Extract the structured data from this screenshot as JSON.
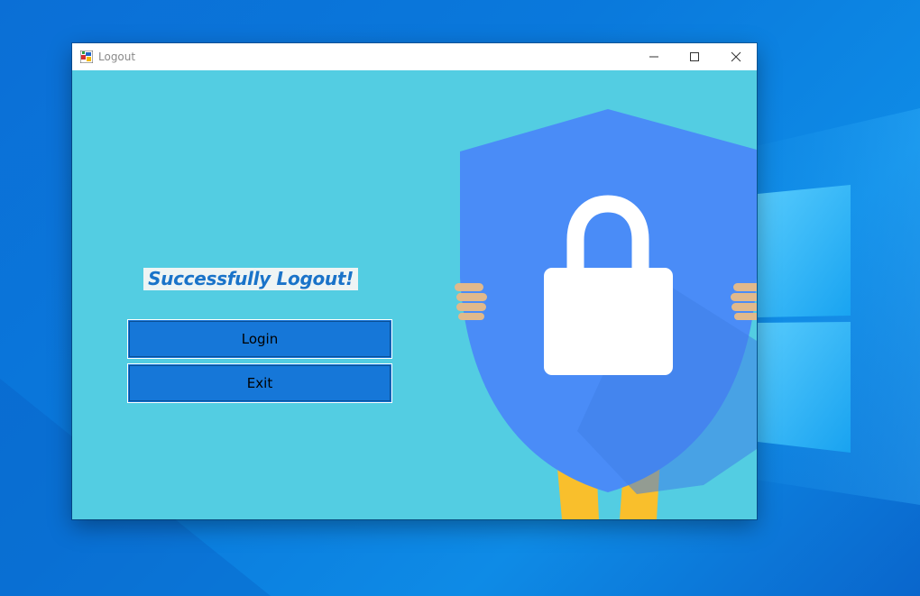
{
  "window": {
    "title": "Logout",
    "icon": "app-icon"
  },
  "caption_buttons": {
    "minimize_icon": "minimize-icon",
    "maximize_icon": "maximize-icon",
    "close_icon": "close-icon"
  },
  "main": {
    "status_text": "Successfully Logout!",
    "login_label": "Login",
    "exit_label": "Exit"
  },
  "illustration": {
    "icon": "shield-lock-icon"
  },
  "colors": {
    "client_background": "#53cde2",
    "shield": "#4a8cf7",
    "button": "#1677d8",
    "status_text": "#1a73c9"
  }
}
